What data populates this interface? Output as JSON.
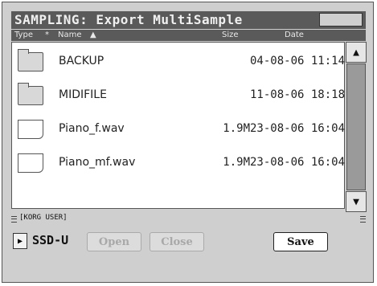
{
  "window": {
    "title": "SAMPLING: Export MultiSample"
  },
  "columns": {
    "type": "Type",
    "star": "*",
    "name": "Name",
    "name_sort": "▲",
    "size": "Size",
    "date": "Date"
  },
  "files": [
    {
      "kind": "folder",
      "icon": "folder-icon",
      "name": "BACKUP",
      "size": "",
      "date": "04-08-06 11:14"
    },
    {
      "kind": "folder",
      "icon": "folder-icon",
      "name": "MIDIFILE",
      "size": "",
      "date": "11-08-06 18:18"
    },
    {
      "kind": "file",
      "icon": "file-icon",
      "name": "Piano_f.wav",
      "size": "1.9M",
      "date": "23-08-06 16:04"
    },
    {
      "kind": "file",
      "icon": "file-icon",
      "name": "Piano_mf.wav",
      "size": "1.9M",
      "date": "23-08-06 16:04"
    }
  ],
  "scroll": {
    "up": "▲",
    "down": "▼"
  },
  "path": {
    "label": "[KORG USER]"
  },
  "device": {
    "arrow": "▶",
    "label": "SSD-U"
  },
  "buttons": {
    "open": "Open",
    "close": "Close",
    "save": "Save"
  }
}
